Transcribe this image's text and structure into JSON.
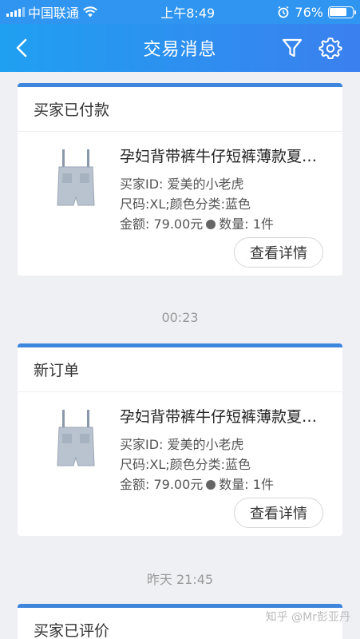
{
  "status_bar": {
    "carrier": "中国联通",
    "time": "上午8:49",
    "battery_percent": "76%",
    "battery_level": 0.76
  },
  "nav": {
    "title": "交易消息",
    "back_icon": "chevron-left-icon",
    "filter_icon": "filter-icon",
    "settings_icon": "gear-icon",
    "accent": "#2f95f0"
  },
  "messages": [
    {
      "status": "买家已付款",
      "product_name": "孕妇背带裤牛仔短裤薄款夏…",
      "buyer": "买家ID: 爱美的小老虎",
      "spec": "尺码:XL;颜色分类:蓝色",
      "amount": "金额: 79.00元",
      "quantity": "数量: 1件",
      "button": "查看详情"
    },
    {
      "time": "00:23",
      "status": "新订单",
      "product_name": "孕妇背带裤牛仔短裤薄款夏…",
      "buyer": "买家ID: 爱美的小老虎",
      "spec": "尺码:XL;颜色分类:蓝色",
      "amount": "金额: 79.00元",
      "quantity": "数量: 1件",
      "button": "查看详情"
    },
    {
      "time": "昨天 21:45",
      "status": "买家已评价"
    }
  ],
  "watermark": "知乎 @Mr彭亚丹"
}
